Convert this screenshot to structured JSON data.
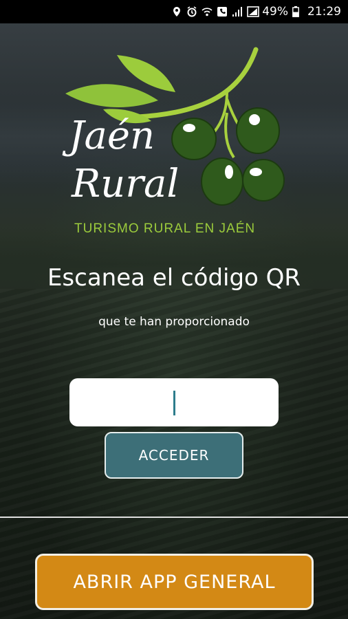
{
  "status_bar": {
    "battery": "49%",
    "time": "21:29",
    "icons": [
      "location-icon",
      "alarm-icon",
      "wifi-call-icon",
      "phone-icon",
      "signal-icon",
      "signal-box-icon",
      "battery-icon"
    ]
  },
  "logo": {
    "line1": "Jaén",
    "line2": "Rural",
    "tagline": "TURISMO RURAL EN JAÉN"
  },
  "main": {
    "title": "Escanea el código QR",
    "subtitle": "que te han proporcionado",
    "code_value": "",
    "code_placeholder": "",
    "submit_label": "ACCEDER"
  },
  "footer": {
    "general_app_label": "ABRIR APP GENERAL"
  },
  "colors": {
    "accent_green": "#9ccc3c",
    "button_teal": "#3d6f78",
    "button_orange": "#d38915"
  }
}
